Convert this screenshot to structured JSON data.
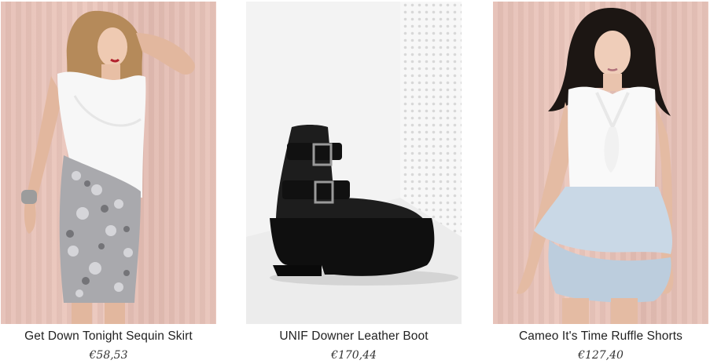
{
  "products": [
    {
      "name": "Get Down Tonight Sequin Skirt",
      "price": "€58,53",
      "image": "model-sequin-skirt"
    },
    {
      "name": "UNIF Downer Leather Boot",
      "price": "€170,44",
      "image": "black-platform-boot"
    },
    {
      "name": "Cameo It's Time Ruffle Shorts",
      "price": "€127,40",
      "image": "model-ruffle-shorts"
    }
  ],
  "colors": {
    "backdrop_pink": "#e6c0b6",
    "backdrop_white": "#f4f4f4",
    "text": "#222222"
  }
}
